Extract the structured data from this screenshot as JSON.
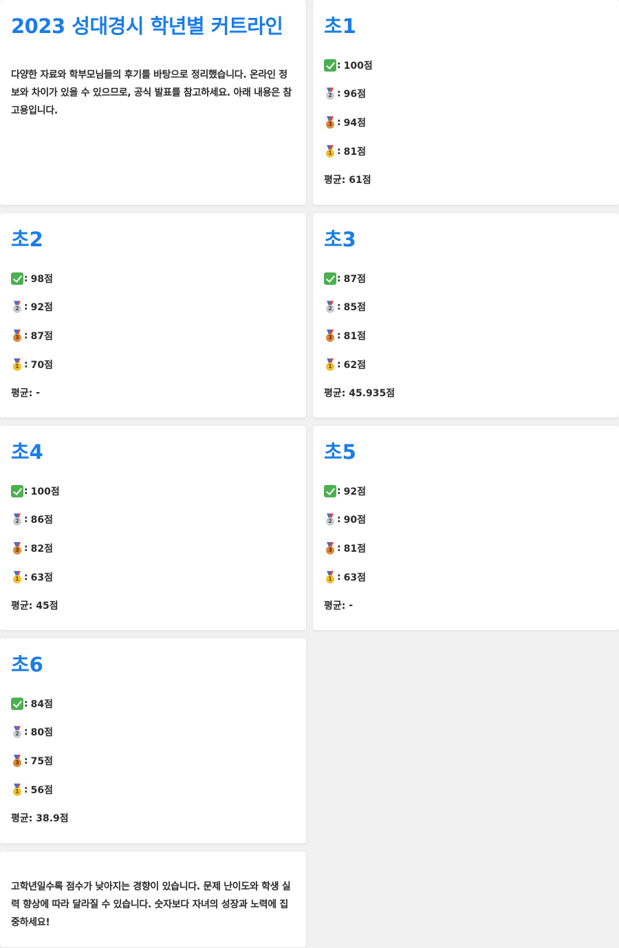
{
  "header": {
    "title": "2023 성대경시 학년별 커트라인",
    "intro": "다양한 자료와 학부모님들의 후기를 바탕으로 정리했습니다. 온라인 정보와 차이가 있을 수 있으므로, 공식 발표를 참고하세요. 아래 내용은 참고용입니다."
  },
  "labels": {
    "separator": ":",
    "average_prefix": "평균:"
  },
  "icons": {
    "perfect": "check-mark-icon",
    "silver": "silver-medal-icon",
    "bronze": "bronze-medal-icon",
    "gold": "gold-medal-icon"
  },
  "grades": [
    {
      "name": "초1",
      "perfect": "100점",
      "silver": "96점",
      "bronze": "94점",
      "gold": "81점",
      "average": "61점"
    },
    {
      "name": "초2",
      "perfect": "98점",
      "silver": "92점",
      "bronze": "87점",
      "gold": "70점",
      "average": "-"
    },
    {
      "name": "초3",
      "perfect": "87점",
      "silver": "85점",
      "bronze": "81점",
      "gold": "62점",
      "average": "45.935점"
    },
    {
      "name": "초4",
      "perfect": "100점",
      "silver": "86점",
      "bronze": "82점",
      "gold": "63점",
      "average": "45점"
    },
    {
      "name": "초5",
      "perfect": "92점",
      "silver": "90점",
      "bronze": "81점",
      "gold": "63점",
      "average": "-"
    },
    {
      "name": "초6",
      "perfect": "84점",
      "silver": "80점",
      "bronze": "75점",
      "gold": "56점",
      "average": "38.9점"
    }
  ],
  "footer": {
    "note": "고학년일수록 점수가 낮아지는 경향이 있습니다. 문제 난이도와 학생 실력 향상에 따라 달라질 수 있습니다. 숫자보다 자녀의 성장과 노력에 집중하세요!"
  },
  "colors": {
    "accent": "#1a7de8",
    "background": "#f1f1f1",
    "card": "#ffffff"
  }
}
